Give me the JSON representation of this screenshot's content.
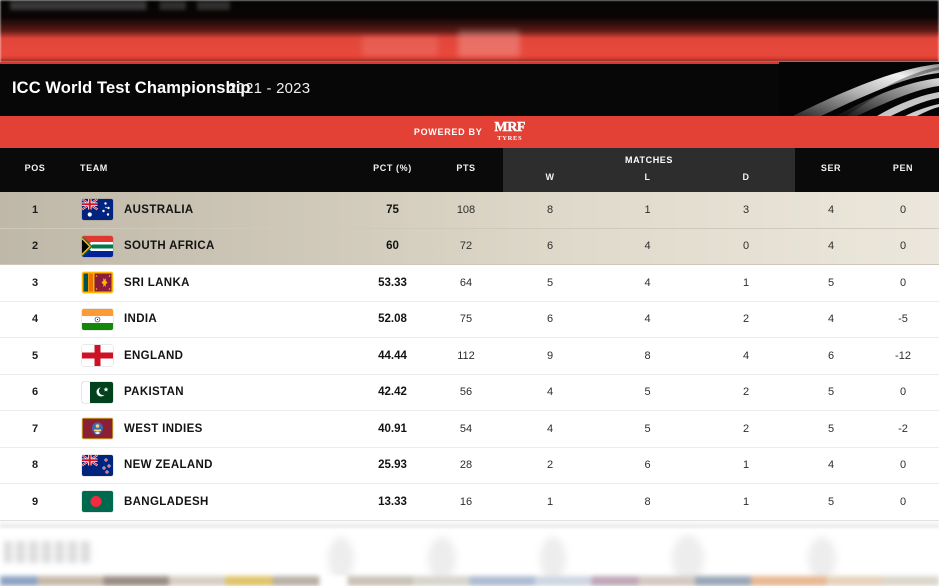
{
  "header": {
    "title": "ICC World Test Championship",
    "years": "2021 - 2023",
    "powered_by_label": "POWERED BY",
    "sponsor_name": "MRF",
    "sponsor_sub": "TYRES"
  },
  "colors": {
    "accent_red": "#e34136",
    "header_black": "#0a0a0a",
    "matches_panel": "#2d2d2d",
    "highlight_left": "#bfb8a9",
    "highlight_right": "#ece7dc"
  },
  "table": {
    "columns": {
      "pos": "POS",
      "team": "TEAM",
      "pct": "PCT (%)",
      "pts": "PTS",
      "matches_group": "MATCHES",
      "w": "W",
      "l": "L",
      "d": "D",
      "ser": "SER",
      "pen": "PEN"
    },
    "rows": [
      {
        "pos": "1",
        "team": "AUSTRALIA",
        "flag": "flag-australia",
        "pct": "75",
        "pts": "108",
        "w": "8",
        "l": "1",
        "d": "3",
        "ser": "4",
        "pen": "0",
        "highlighted": true
      },
      {
        "pos": "2",
        "team": "SOUTH AFRICA",
        "flag": "flag-south-africa",
        "pct": "60",
        "pts": "72",
        "w": "6",
        "l": "4",
        "d": "0",
        "ser": "4",
        "pen": "0",
        "highlighted": true
      },
      {
        "pos": "3",
        "team": "SRI LANKA",
        "flag": "flag-sri-lanka",
        "pct": "53.33",
        "pts": "64",
        "w": "5",
        "l": "4",
        "d": "1",
        "ser": "5",
        "pen": "0",
        "highlighted": false
      },
      {
        "pos": "4",
        "team": "INDIA",
        "flag": "flag-india",
        "pct": "52.08",
        "pts": "75",
        "w": "6",
        "l": "4",
        "d": "2",
        "ser": "4",
        "pen": "-5",
        "highlighted": false
      },
      {
        "pos": "5",
        "team": "ENGLAND",
        "flag": "flag-england",
        "pct": "44.44",
        "pts": "112",
        "w": "9",
        "l": "8",
        "d": "4",
        "ser": "6",
        "pen": "-12",
        "highlighted": false
      },
      {
        "pos": "6",
        "team": "PAKISTAN",
        "flag": "flag-pakistan",
        "pct": "42.42",
        "pts": "56",
        "w": "4",
        "l": "5",
        "d": "2",
        "ser": "5",
        "pen": "0",
        "highlighted": false
      },
      {
        "pos": "7",
        "team": "WEST INDIES",
        "flag": "flag-west-indies",
        "pct": "40.91",
        "pts": "54",
        "w": "4",
        "l": "5",
        "d": "2",
        "ser": "5",
        "pen": "-2",
        "highlighted": false
      },
      {
        "pos": "8",
        "team": "NEW ZEALAND",
        "flag": "flag-new-zealand",
        "pct": "25.93",
        "pts": "28",
        "w": "2",
        "l": "6",
        "d": "1",
        "ser": "4",
        "pen": "0",
        "highlighted": false
      },
      {
        "pos": "9",
        "team": "BANGLADESH",
        "flag": "flag-bangladesh",
        "pct": "13.33",
        "pts": "16",
        "w": "1",
        "l": "8",
        "d": "1",
        "ser": "5",
        "pen": "0",
        "highlighted": false
      }
    ]
  }
}
